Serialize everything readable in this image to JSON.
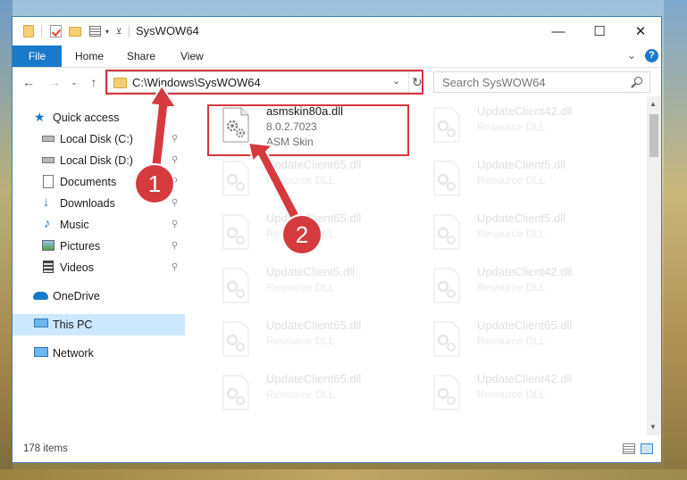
{
  "window": {
    "title": "SysWOW64"
  },
  "ribbon": {
    "tabs": [
      "File",
      "Home",
      "Share",
      "View"
    ],
    "help": "?"
  },
  "address": {
    "path": "C:\\Windows\\SysWOW64",
    "search_placeholder": "Search SysWOW64"
  },
  "sidebar": {
    "quick_access": "Quick access",
    "items": [
      {
        "label": "Local Disk (C:)",
        "icon": "drive-icon"
      },
      {
        "label": "Local Disk (D:)",
        "icon": "drive-icon"
      },
      {
        "label": "Documents",
        "icon": "documents-icon"
      },
      {
        "label": "Downloads",
        "icon": "downloads-icon"
      },
      {
        "label": "Music",
        "icon": "music-icon"
      },
      {
        "label": "Pictures",
        "icon": "pictures-icon"
      },
      {
        "label": "Videos",
        "icon": "videos-icon"
      }
    ],
    "onedrive": "OneDrive",
    "this_pc": "This PC",
    "network": "Network"
  },
  "files": {
    "selected": {
      "name": "asmskin80a.dll",
      "version": "8.0.2.7023",
      "description": "ASM Skin"
    },
    "left_column": [
      {
        "name": "UpdateClient65.dll",
        "type": "Resource DLL"
      },
      {
        "name": "UpdateClient65.dll",
        "type": "Resource DLL"
      },
      {
        "name": "UpdateClient5.dll",
        "type": "Resource DLL"
      },
      {
        "name": "UpdateClient65.dll",
        "type": "Resource DLL"
      },
      {
        "name": "UpdateClient65.dll",
        "type": "Resource DLL"
      }
    ],
    "right_column": [
      {
        "name": "UpdateClient42.dll",
        "type": "Resource DLL"
      },
      {
        "name": "UpdateClient5.dll",
        "type": "Resource DLL"
      },
      {
        "name": "UpdateClient5.dll",
        "type": "Resource DLL"
      },
      {
        "name": "UpdateClient42.dll",
        "type": "Resource DLL"
      },
      {
        "name": "UpdateClient65.dll",
        "type": "Resource DLL"
      },
      {
        "name": "UpdateClient42.dll",
        "type": "Resource DLL"
      }
    ]
  },
  "status": {
    "item_count": "178 items"
  },
  "annotations": {
    "step1": "1",
    "step2": "2",
    "highlight_color": "#d9363e"
  }
}
